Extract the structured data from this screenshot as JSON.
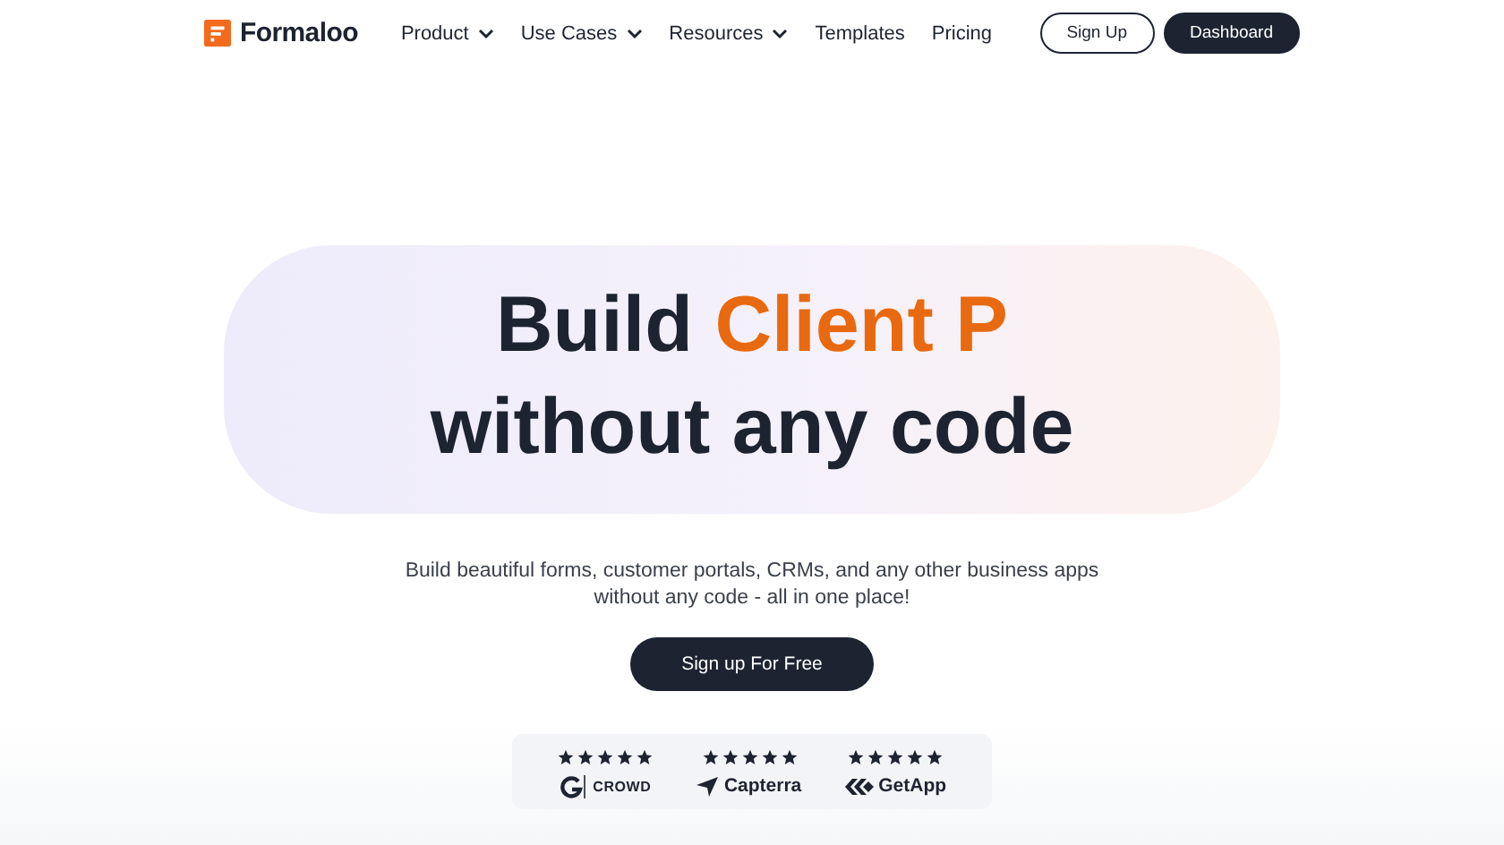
{
  "nav": {
    "logo": "Formaloo",
    "menu": [
      {
        "label": "Product",
        "dropdown": true
      },
      {
        "label": "Use Cases",
        "dropdown": true
      },
      {
        "label": "Resources",
        "dropdown": true
      },
      {
        "label": "Templates",
        "dropdown": false
      },
      {
        "label": "Pricing",
        "dropdown": false
      }
    ],
    "buttons": [
      {
        "label": "Sign Up",
        "kind": "outline"
      },
      {
        "label": "Dashboard",
        "kind": "solid"
      }
    ]
  },
  "hero": {
    "headline_lead": "Build",
    "headline_highlight": "Client P",
    "headline_tail": "without any code",
    "subtitle": "Build beautiful forms, customer portals, CRMs, and any other business apps without any code - all in one place!",
    "cta": "Sign up For Free"
  },
  "ratings": [
    {
      "stars": 5,
      "kind": "g2",
      "label": "CROWD"
    },
    {
      "stars": 5,
      "kind": "capterra",
      "label": "Capterra"
    },
    {
      "stars": 5,
      "kind": "getapp",
      "label": "GetApp"
    }
  ]
}
